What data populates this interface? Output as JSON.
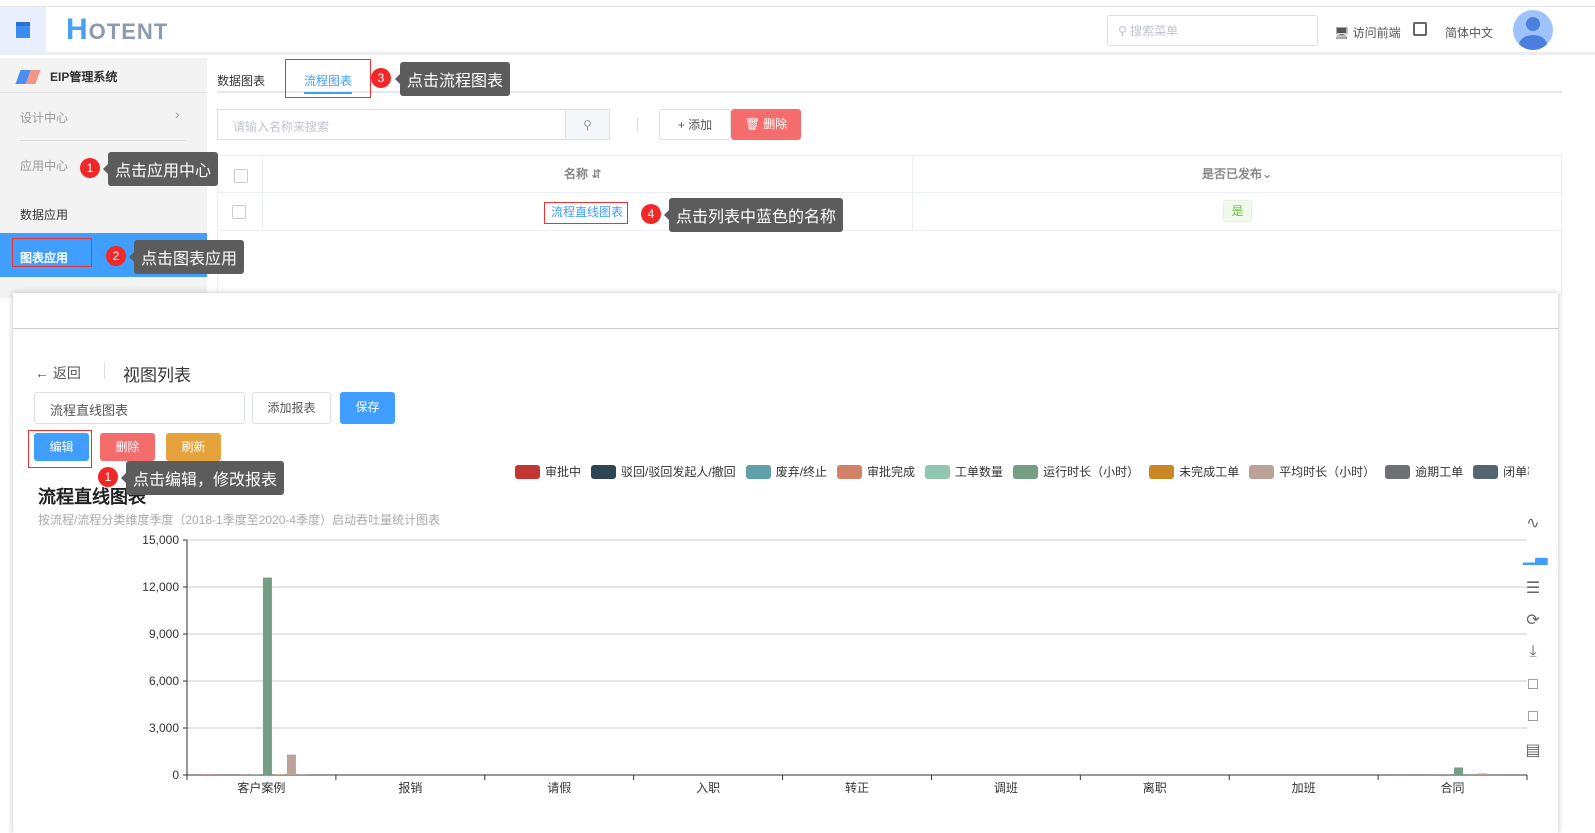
{
  "header": {
    "logo_main": "H",
    "logo_rest": "OTENT",
    "search_placeholder": "搜索菜单",
    "visit_front": "访问前端",
    "language": "简体中文"
  },
  "sidebar": {
    "system": "EIP管理系统",
    "items": [
      {
        "label": "设计中心"
      },
      {
        "label": "应用中心"
      },
      {
        "label": "数据应用"
      },
      {
        "label": "图表应用"
      }
    ]
  },
  "tabs": [
    {
      "label": "数据图表"
    },
    {
      "label": "流程图表"
    }
  ],
  "toolbar": {
    "search_placeholder": "请输入名称来搜索",
    "add_label": "+ 添加",
    "delete_label": "删除"
  },
  "table": {
    "columns": [
      "名称",
      "是否已发布"
    ],
    "rows": [
      {
        "name": "流程直线图表",
        "published": "是"
      }
    ]
  },
  "annotations": [
    {
      "num": "1",
      "text": "点击应用中心"
    },
    {
      "num": "2",
      "text": "点击图表应用"
    },
    {
      "num": "3",
      "text": "点击流程图表"
    },
    {
      "num": "4",
      "text": "点击列表中蓝色的名称"
    },
    {
      "num": "1",
      "text": "点击编辑，修改报表"
    }
  ],
  "view": {
    "back": "返回",
    "title": "视图列表",
    "name_value": "流程直线图表",
    "add_report": "添加报表",
    "save": "保存",
    "edit": "编辑",
    "delete": "删除",
    "refresh": "刷新"
  },
  "chart_data": {
    "type": "bar",
    "title": "流程直线图表",
    "subtitle": "按流程/流程分类维度季度（2018-1季度至2020-4季度）启动吞吐量统计图表",
    "categories": [
      "客户案例",
      "报销",
      "请假",
      "入职",
      "转正",
      "调班",
      "离职",
      "加班",
      "合同"
    ],
    "ylim": [
      0,
      15000
    ],
    "yticks": [
      "0",
      "3,000",
      "6,000",
      "9,000",
      "12,000",
      "15,000"
    ],
    "legend_position": "top-right",
    "series": [
      {
        "name": "审批中",
        "color": "#c23531",
        "values": [
          20,
          0,
          0,
          0,
          0,
          0,
          0,
          0,
          5
        ]
      },
      {
        "name": "驳回/驳回发起人/撤回",
        "color": "#2f4554",
        "values": [
          0,
          0,
          0,
          0,
          0,
          0,
          0,
          0,
          0
        ]
      },
      {
        "name": "废弃/终止",
        "color": "#61a0a8",
        "values": [
          0,
          0,
          0,
          0,
          0,
          0,
          0,
          0,
          0
        ]
      },
      {
        "name": "审批完成",
        "color": "#d48265",
        "values": [
          10,
          0,
          0,
          0,
          0,
          0,
          0,
          0,
          5
        ]
      },
      {
        "name": "工单数量",
        "color": "#91c7ae",
        "values": [
          10,
          0,
          0,
          0,
          0,
          0,
          0,
          0,
          5
        ]
      },
      {
        "name": "运行时长（小时）",
        "color": "#749f83",
        "values": [
          12600,
          0,
          0,
          0,
          0,
          0,
          0,
          0,
          480
        ]
      },
      {
        "name": "未完成工单",
        "color": "#ca8622",
        "values": [
          20,
          0,
          0,
          0,
          0,
          0,
          0,
          0,
          5
        ]
      },
      {
        "name": "平均时长（小时）",
        "color": "#bda29a",
        "values": [
          1300,
          0,
          0,
          0,
          0,
          0,
          0,
          0,
          100
        ]
      },
      {
        "name": "逾期工单",
        "color": "#6e7074",
        "values": [
          20,
          0,
          0,
          0,
          0,
          0,
          0,
          0,
          5
        ]
      },
      {
        "name": "闭单率",
        "color": "#546570",
        "values": [
          0,
          0,
          0,
          0,
          0,
          0,
          0,
          0,
          0
        ]
      }
    ]
  }
}
